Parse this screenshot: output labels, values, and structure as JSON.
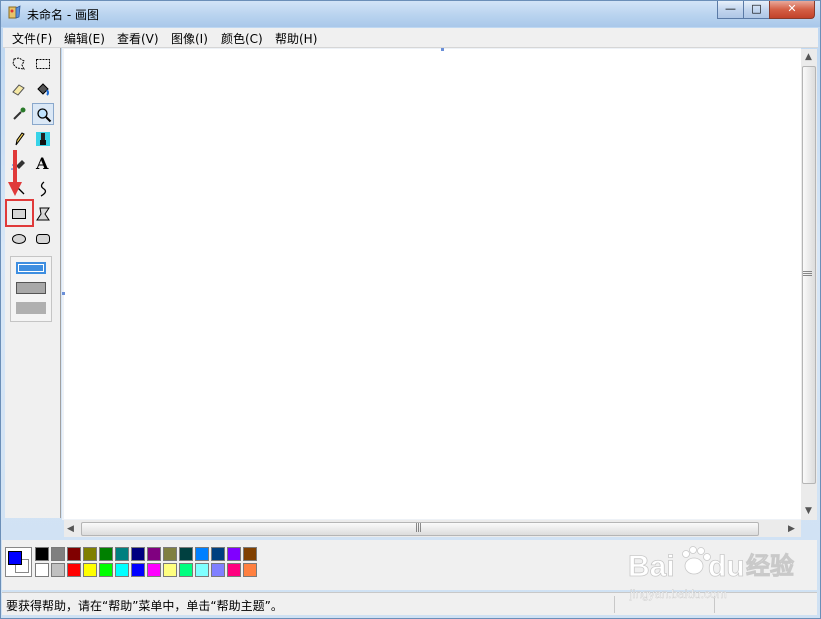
{
  "window": {
    "title": "未命名 - 画图",
    "controls": {
      "minimize": "—",
      "maximize": "□",
      "close": "✕"
    }
  },
  "menubar": {
    "items": [
      {
        "label": "文件(F)"
      },
      {
        "label": "编辑(E)"
      },
      {
        "label": "查看(V)"
      },
      {
        "label": "图像(I)"
      },
      {
        "label": "颜色(C)"
      },
      {
        "label": "帮助(H)"
      }
    ]
  },
  "toolbox": {
    "tools": [
      {
        "icon": "free-select-icon"
      },
      {
        "icon": "rect-select-icon"
      },
      {
        "icon": "eraser-icon"
      },
      {
        "icon": "fill-bucket-icon"
      },
      {
        "icon": "eyedropper-icon"
      },
      {
        "icon": "magnifier-icon",
        "selected": true
      },
      {
        "icon": "pencil-icon"
      },
      {
        "icon": "brush-icon"
      },
      {
        "icon": "airbrush-icon"
      },
      {
        "icon": "text-icon"
      },
      {
        "icon": "line-icon"
      },
      {
        "icon": "curve-icon"
      },
      {
        "icon": "rectangle-icon"
      },
      {
        "icon": "polygon-icon"
      },
      {
        "icon": "ellipse-icon"
      },
      {
        "icon": "rounded-rect-icon"
      }
    ],
    "highlighted_tool": "rectangle-icon",
    "text_tool_glyph": "A",
    "fill_options": [
      "outline-only",
      "outline-and-fill",
      "fill-only"
    ],
    "selected_fill_option": "outline-only"
  },
  "palette": {
    "foreground": "#0000ff",
    "background": "#ffffff",
    "row1": [
      "#000000",
      "#808080",
      "#800000",
      "#808000",
      "#008000",
      "#008080",
      "#000080",
      "#800080",
      "#808040",
      "#004040",
      "#0080ff",
      "#004080",
      "#8000ff",
      "#804000"
    ],
    "row2": [
      "#ffffff",
      "#c0c0c0",
      "#ff0000",
      "#ffff00",
      "#00ff00",
      "#00ffff",
      "#0000ff",
      "#ff00ff",
      "#ffff80",
      "#00ff80",
      "#80ffff",
      "#8080ff",
      "#ff0080",
      "#ff8040"
    ]
  },
  "statusbar": {
    "text": "要获得帮助，请在“帮助”菜单中，单击“帮助主题”。"
  },
  "canvas": {
    "background": "#ffffff"
  },
  "scrollbars": {
    "grip": "|||"
  },
  "watermark": {
    "brand": "Bai",
    "brand2": "du",
    "cn": "经验",
    "url": "jingyan.baidu.com"
  }
}
